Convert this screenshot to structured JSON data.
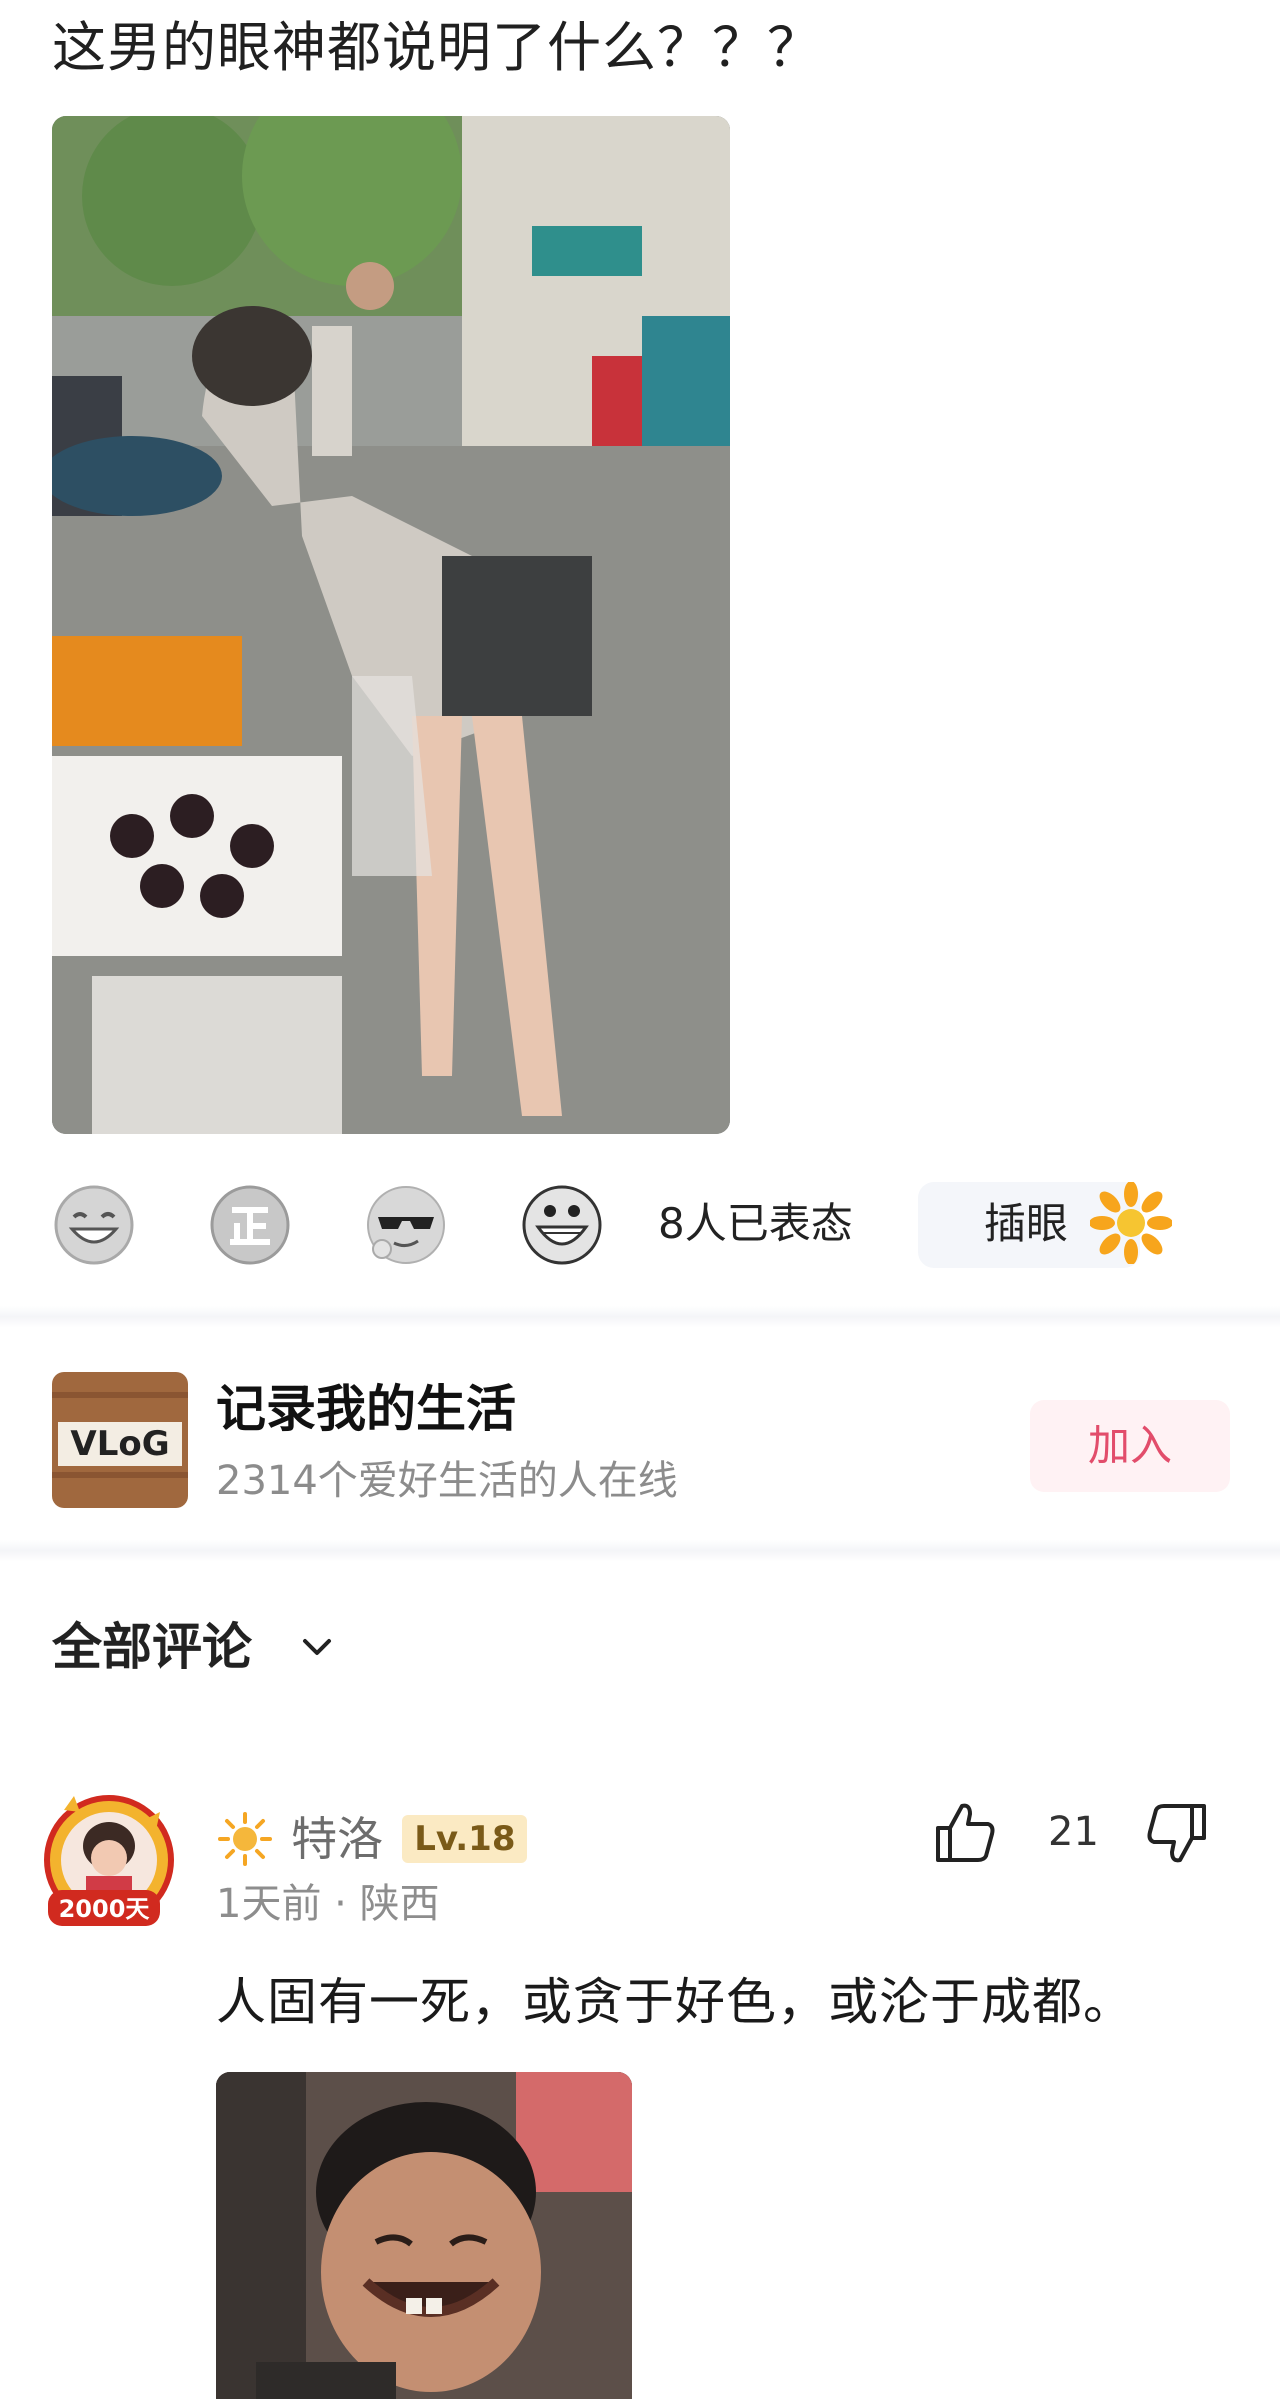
{
  "post": {
    "title": "这男的眼神都说明了什么？？？",
    "image_icon": "street-photo"
  },
  "reactions": {
    "emojis": [
      "laughing-face-icon",
      "zheng-badge-icon",
      "sunglasses-face-icon",
      "grinning-face-icon"
    ],
    "count_text": "8人已表态",
    "tag_label": "插眼",
    "tag_icon": "sunflower-icon"
  },
  "circle": {
    "logo_text": "VLoG",
    "name": "记录我的生活",
    "meta": "2314个爱好生活的人在线",
    "join_label": "加入"
  },
  "comments": {
    "header": "全部评论",
    "items": [
      {
        "avatar_badge": "2000天",
        "username": "特洛",
        "level": "Lv.18",
        "meta": "1天前 · 陕西",
        "likes": "21",
        "text": "人固有一死，或贪于好色，或沦于成都。"
      }
    ]
  },
  "colors": {
    "accent": "#e24d6b",
    "level_bg": "#fbeac3",
    "muted": "#8c8c8c"
  }
}
